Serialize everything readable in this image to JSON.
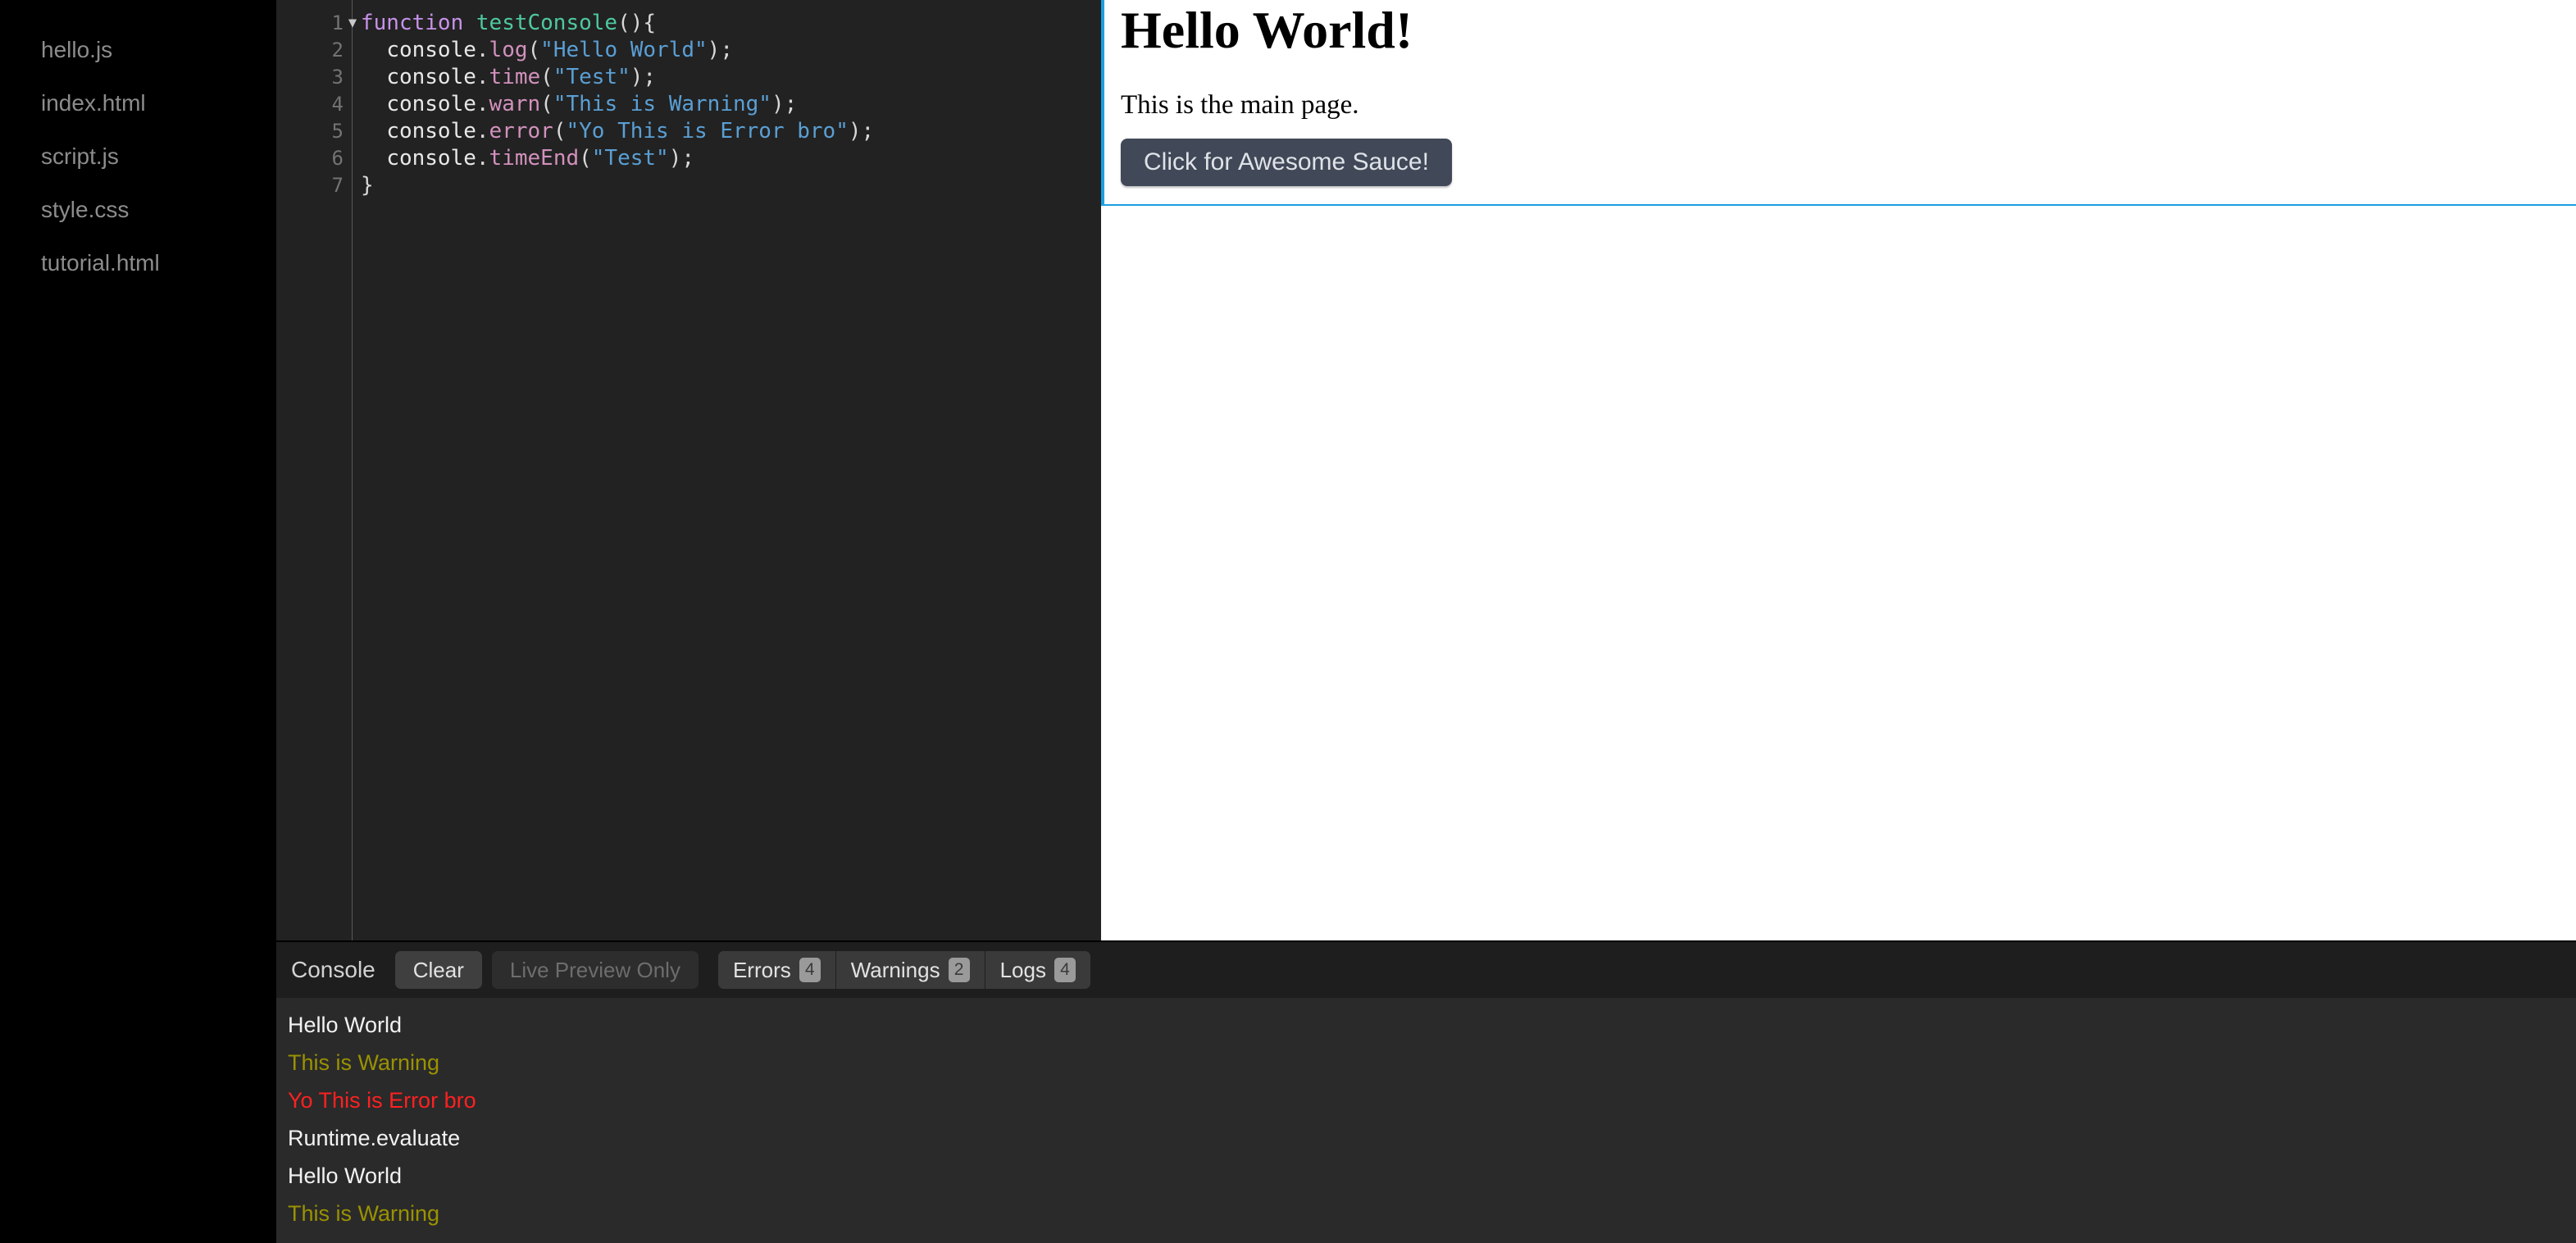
{
  "sidebar": {
    "files": [
      {
        "name": "hello.js"
      },
      {
        "name": "index.html"
      },
      {
        "name": "script.js"
      },
      {
        "name": "style.css"
      },
      {
        "name": "tutorial.html"
      }
    ]
  },
  "editor": {
    "filename": "hello.js",
    "fold_arrow": "▼",
    "lines": [
      {
        "number": "1",
        "foldable": true
      },
      {
        "number": "2",
        "foldable": false
      },
      {
        "number": "3",
        "foldable": false
      },
      {
        "number": "4",
        "foldable": false
      },
      {
        "number": "5",
        "foldable": false
      },
      {
        "number": "6",
        "foldable": false
      },
      {
        "number": "7",
        "foldable": false
      }
    ],
    "code": {
      "l1_kw": "function",
      "l1_sp": " ",
      "l1_fn": "testConsole",
      "l1_punc": "(){",
      "l2_indent": "  ",
      "l2_obj": "console",
      "l2_dot": ".",
      "l2_method": "log",
      "l2_open": "(",
      "l2_str": "\"Hello World\"",
      "l2_close": ");",
      "l3_indent": "  ",
      "l3_obj": "console",
      "l3_dot": ".",
      "l3_method": "time",
      "l3_open": "(",
      "l3_str": "\"Test\"",
      "l3_close": ");",
      "l4_indent": "  ",
      "l4_obj": "console",
      "l4_dot": ".",
      "l4_method": "warn",
      "l4_open": "(",
      "l4_str": "\"This is Warning\"",
      "l4_close": ");",
      "l5_indent": "  ",
      "l5_obj": "console",
      "l5_dot": ".",
      "l5_method": "error",
      "l5_open": "(",
      "l5_str": "\"Yo This is Error bro\"",
      "l5_close": ");",
      "l6_indent": "  ",
      "l6_obj": "console",
      "l6_dot": ".",
      "l6_method": "timeEnd",
      "l6_open": "(",
      "l6_str": "\"Test\"",
      "l6_close": ");",
      "l7_punc": "}"
    }
  },
  "preview": {
    "heading": "Hello World!",
    "paragraph": "This is the main page.",
    "button_label": "Click for Awesome Sauce!",
    "highlight_color": "#1b9fe0",
    "button_color": "#414857"
  },
  "console": {
    "title": "Console",
    "clear_label": "Clear",
    "live_preview_label": "Live Preview Only",
    "filters": [
      {
        "label": "Errors",
        "count": "4"
      },
      {
        "label": "Warnings",
        "count": "2"
      },
      {
        "label": "Logs",
        "count": "4"
      }
    ],
    "messages": [
      {
        "text": "Hello World",
        "level": "log"
      },
      {
        "text": "This is Warning",
        "level": "warn"
      },
      {
        "text": "Yo This is Error bro",
        "level": "error"
      },
      {
        "text": "Runtime.evaluate",
        "level": "log"
      },
      {
        "text": "Hello World",
        "level": "log"
      },
      {
        "text": "This is Warning",
        "level": "warn"
      }
    ]
  }
}
